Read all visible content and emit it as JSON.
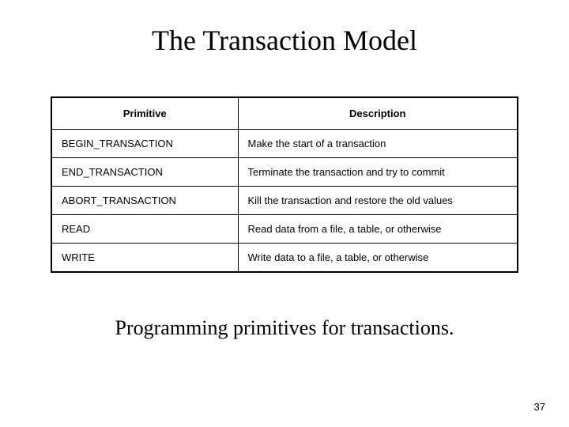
{
  "title": "The Transaction Model",
  "table": {
    "headers": {
      "primitive": "Primitive",
      "description": "Description"
    },
    "rows": [
      {
        "primitive": "BEGIN_TRANSACTION",
        "description": "Make the start of a transaction"
      },
      {
        "primitive": "END_TRANSACTION",
        "description": "Terminate the transaction and try to commit"
      },
      {
        "primitive": "ABORT_TRANSACTION",
        "description": "Kill the transaction and restore the old values"
      },
      {
        "primitive": "READ",
        "description": "Read data from a file, a table, or otherwise"
      },
      {
        "primitive": "WRITE",
        "description": "Write data to a file, a table, or otherwise"
      }
    ]
  },
  "caption": "Programming  primitives for transactions.",
  "page_number": "37"
}
